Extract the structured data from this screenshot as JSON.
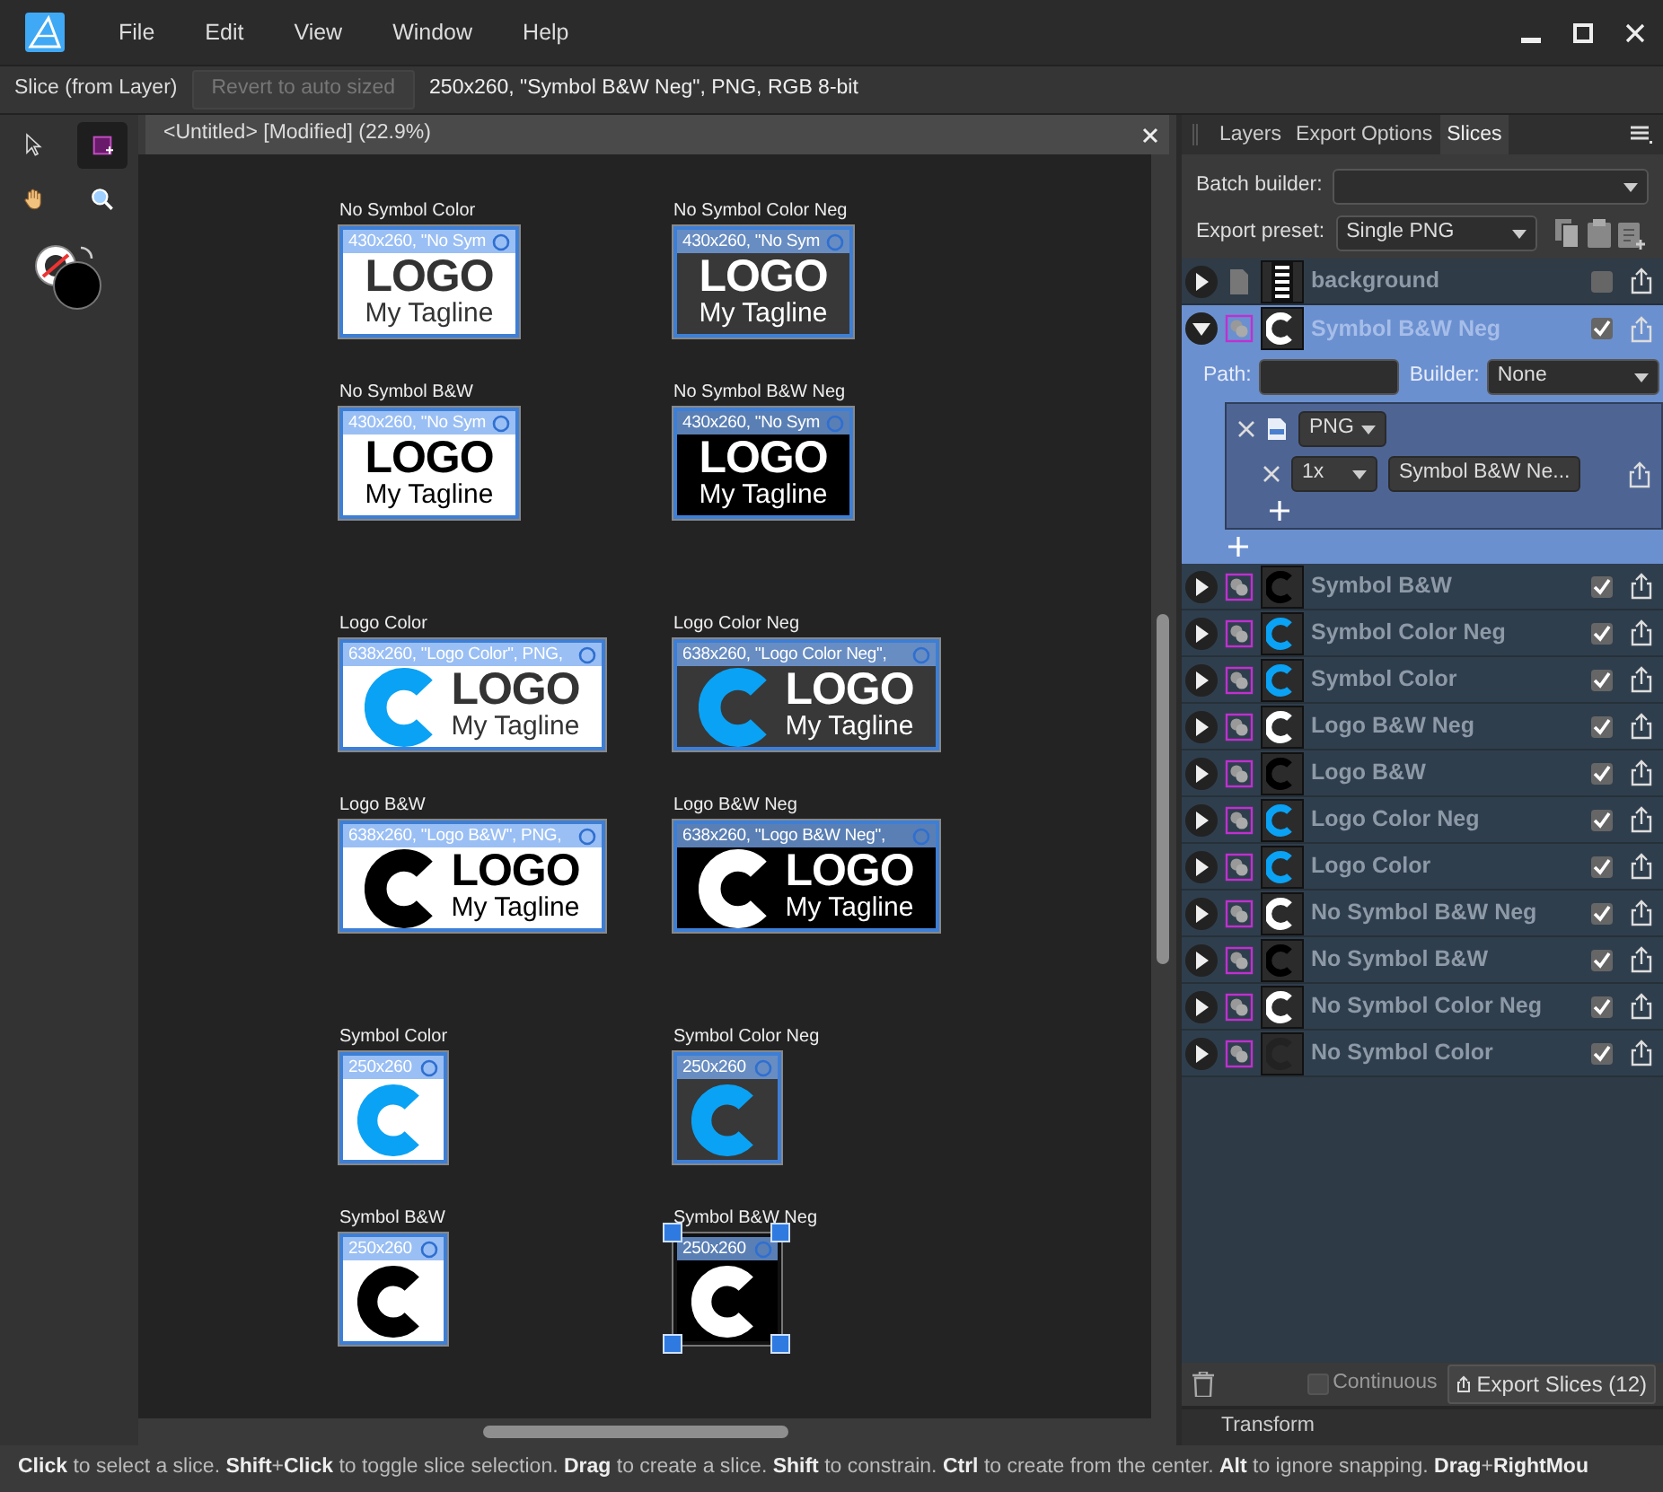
{
  "menu": [
    {
      "label": "File"
    },
    {
      "label": "Edit"
    },
    {
      "label": "View"
    },
    {
      "label": "Window"
    },
    {
      "label": "Help"
    }
  ],
  "context_bar": {
    "tool": "Slice (from Layer)",
    "revert_button": {
      "label": "Revert to auto sized",
      "disabled": true
    },
    "info": "250x260, \"Symbol B&W Neg\", PNG, RGB 8-bit"
  },
  "tools": [
    {
      "kind": "pointer",
      "selected": false
    },
    {
      "kind": "slice",
      "selected": true
    },
    {
      "kind": "hand",
      "selected": false
    },
    {
      "kind": "zoom",
      "selected": false
    }
  ],
  "document_tab": {
    "title": "<Untitled> [Modified] (22.9%)"
  },
  "artboard_rows": [
    {
      "tiles": [
        {
          "label": "No Symbol Color",
          "caption": "430x260, \"No Sym",
          "kind": "no-symbol",
          "colored": true,
          "negative": false,
          "logo_text": "LOGO",
          "tagline": "My Tagline",
          "selected": false
        },
        {
          "label": "No Symbol Color Neg",
          "caption": "430x260, \"No Sym",
          "kind": "no-symbol",
          "colored": true,
          "negative": true,
          "logo_text": "LOGO",
          "tagline": "My Tagline",
          "selected": false
        }
      ]
    },
    {
      "tiles": [
        {
          "label": "No Symbol B&W",
          "caption": "430x260, \"No Sym",
          "kind": "no-symbol",
          "colored": false,
          "negative": false,
          "logo_text": "LOGO",
          "tagline": "My Tagline",
          "selected": false
        },
        {
          "label": "No Symbol B&W Neg",
          "caption": "430x260, \"No Sym",
          "kind": "no-symbol",
          "colored": false,
          "negative": true,
          "logo_text": "LOGO",
          "tagline": "My Tagline",
          "selected": false
        }
      ]
    },
    {
      "tiles": [
        {
          "label": "Logo Color",
          "caption": "638x260, \"Logo Color\", PNG,",
          "kind": "logo",
          "colored": true,
          "negative": false,
          "logo_text": "LOGO",
          "tagline": "My Tagline",
          "selected": false
        },
        {
          "label": "Logo Color Neg",
          "caption": "638x260, \"Logo Color Neg\",",
          "kind": "logo",
          "colored": true,
          "negative": true,
          "logo_text": "LOGO",
          "tagline": "My Tagline",
          "selected": false
        }
      ]
    },
    {
      "tiles": [
        {
          "label": "Logo B&W",
          "caption": "638x260, \"Logo B&W\", PNG,",
          "kind": "logo",
          "colored": false,
          "negative": false,
          "logo_text": "LOGO",
          "tagline": "My Tagline",
          "selected": false
        },
        {
          "label": "Logo B&W Neg",
          "caption": "638x260, \"Logo B&W Neg\",",
          "kind": "logo",
          "colored": false,
          "negative": true,
          "logo_text": "LOGO",
          "tagline": "My Tagline",
          "selected": false
        }
      ]
    },
    {
      "tiles": [
        {
          "label": "Symbol Color",
          "caption": "250x260",
          "kind": "symbol",
          "colored": true,
          "negative": false,
          "selected": false
        },
        {
          "label": "Symbol Color Neg",
          "caption": "250x260",
          "kind": "symbol",
          "colored": true,
          "negative": true,
          "selected": false
        }
      ]
    },
    {
      "tiles": [
        {
          "label": "Symbol B&W",
          "caption": "250x260",
          "kind": "symbol",
          "colored": false,
          "negative": false,
          "selected": false
        },
        {
          "label": "Symbol B&W Neg",
          "caption": "250x260",
          "kind": "symbol",
          "colored": false,
          "negative": true,
          "selected": true
        }
      ]
    }
  ],
  "panel_tabs": [
    {
      "label": "Layers",
      "selected": false
    },
    {
      "label": "Export Options",
      "selected": false
    },
    {
      "label": "Slices",
      "selected": true
    }
  ],
  "batch_builder": {
    "label": "Batch builder:"
  },
  "export_preset": {
    "label": "Export preset:",
    "value": "Single PNG"
  },
  "slices": [
    {
      "name": "background",
      "kind": "layer",
      "selected": false,
      "expanded": false,
      "checked": false
    },
    {
      "name": "Symbol B&W Neg",
      "kind": "slice",
      "selected": true,
      "expanded": true,
      "checked": true,
      "details": {
        "path_label": "Path:",
        "builder_label": "Builder:",
        "builder": "None",
        "format": "PNG",
        "scale": "1x",
        "filename": "Symbol B&W Ne..."
      }
    },
    {
      "name": "Symbol B&W",
      "kind": "slice",
      "selected": false,
      "expanded": false,
      "checked": true
    },
    {
      "name": "Symbol Color Neg",
      "kind": "slice",
      "selected": false,
      "expanded": false,
      "checked": true
    },
    {
      "name": "Symbol Color",
      "kind": "slice",
      "selected": false,
      "expanded": false,
      "checked": true
    },
    {
      "name": "Logo B&W Neg",
      "kind": "slice",
      "selected": false,
      "expanded": false,
      "checked": true
    },
    {
      "name": "Logo B&W",
      "kind": "slice",
      "selected": false,
      "expanded": false,
      "checked": true
    },
    {
      "name": "Logo Color Neg",
      "kind": "slice",
      "selected": false,
      "expanded": false,
      "checked": true
    },
    {
      "name": "Logo Color",
      "kind": "slice",
      "selected": false,
      "expanded": false,
      "checked": true
    },
    {
      "name": "No Symbol B&W Neg",
      "kind": "slice",
      "selected": false,
      "expanded": false,
      "checked": true
    },
    {
      "name": "No Symbol B&W",
      "kind": "slice",
      "selected": false,
      "expanded": false,
      "checked": true
    },
    {
      "name": "No Symbol Color Neg",
      "kind": "slice",
      "selected": false,
      "expanded": false,
      "checked": true
    },
    {
      "name": "No Symbol Color",
      "kind": "slice",
      "selected": false,
      "expanded": false,
      "checked": true
    }
  ],
  "panel_footer": {
    "continuous": {
      "label": "Continuous",
      "checked": false
    },
    "export_button": "Export Slices (12)"
  },
  "transform_panel": {
    "title": "Transform"
  },
  "status_bar": "**Click** to select a slice. **Shift**+**Click** to toggle slice selection. **Drag** to create a slice. **Shift** to constrain. **Ctrl** to create from the center. **Alt** to ignore snapping. **Drag**+**RightMou**"
}
